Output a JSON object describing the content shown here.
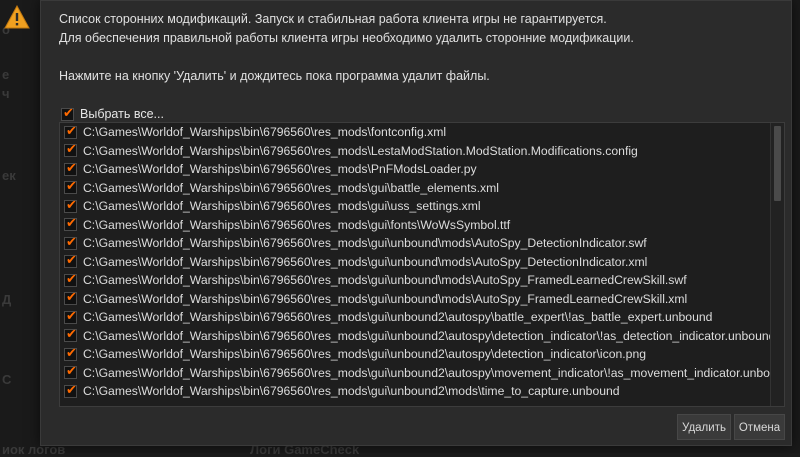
{
  "background": {
    "left_fragments": [
      "о",
      "е",
      "ч",
      "ек",
      "Д",
      "С",
      "иок логов"
    ],
    "bottom_fragment": "Логи GameCheck"
  },
  "dialog": {
    "message_lines": [
      "Список сторонних модификаций. Запуск и стабильная работа клиента игры не гарантируется.",
      "Для обеспечения правильной работы клиента игры необходимо удалить сторонние модификации.",
      "Нажмите на кнопку 'Удалить' и дождитесь пока программа удалит файлы."
    ],
    "select_all_label": "Выбрать все...",
    "files": [
      "C:\\Games\\Worldof_Warships\\bin\\6796560\\res_mods\\fontconfig.xml",
      "C:\\Games\\Worldof_Warships\\bin\\6796560\\res_mods\\LestaModStation.ModStation.Modifications.config",
      "C:\\Games\\Worldof_Warships\\bin\\6796560\\res_mods\\PnFModsLoader.py",
      "C:\\Games\\Worldof_Warships\\bin\\6796560\\res_mods\\gui\\battle_elements.xml",
      "C:\\Games\\Worldof_Warships\\bin\\6796560\\res_mods\\gui\\uss_settings.xml",
      "C:\\Games\\Worldof_Warships\\bin\\6796560\\res_mods\\gui\\fonts\\WoWsSymbol.ttf",
      "C:\\Games\\Worldof_Warships\\bin\\6796560\\res_mods\\gui\\unbound\\mods\\AutoSpy_DetectionIndicator.swf",
      "C:\\Games\\Worldof_Warships\\bin\\6796560\\res_mods\\gui\\unbound\\mods\\AutoSpy_DetectionIndicator.xml",
      "C:\\Games\\Worldof_Warships\\bin\\6796560\\res_mods\\gui\\unbound\\mods\\AutoSpy_FramedLearnedCrewSkill.swf",
      "C:\\Games\\Worldof_Warships\\bin\\6796560\\res_mods\\gui\\unbound\\mods\\AutoSpy_FramedLearnedCrewSkill.xml",
      "C:\\Games\\Worldof_Warships\\bin\\6796560\\res_mods\\gui\\unbound2\\autospy\\battle_expert\\!as_battle_expert.unbound",
      "C:\\Games\\Worldof_Warships\\bin\\6796560\\res_mods\\gui\\unbound2\\autospy\\detection_indicator\\!as_detection_indicator.unbound",
      "C:\\Games\\Worldof_Warships\\bin\\6796560\\res_mods\\gui\\unbound2\\autospy\\detection_indicator\\icon.png",
      "C:\\Games\\Worldof_Warships\\bin\\6796560\\res_mods\\gui\\unbound2\\autospy\\movement_indicator\\!as_movement_indicator.unbound",
      "C:\\Games\\Worldof_Warships\\bin\\6796560\\res_mods\\gui\\unbound2\\mods\\time_to_capture.unbound"
    ],
    "delete_label": "Удалить",
    "cancel_label": "Отмена"
  },
  "colors": {
    "accent": "#ff6a00",
    "warning": "#f0a020",
    "dialog_bg": "#2b2b2b",
    "list_bg": "#1e1e1e"
  },
  "icons": {
    "warning": "warning-triangle-icon",
    "check": "checkmark-icon"
  }
}
